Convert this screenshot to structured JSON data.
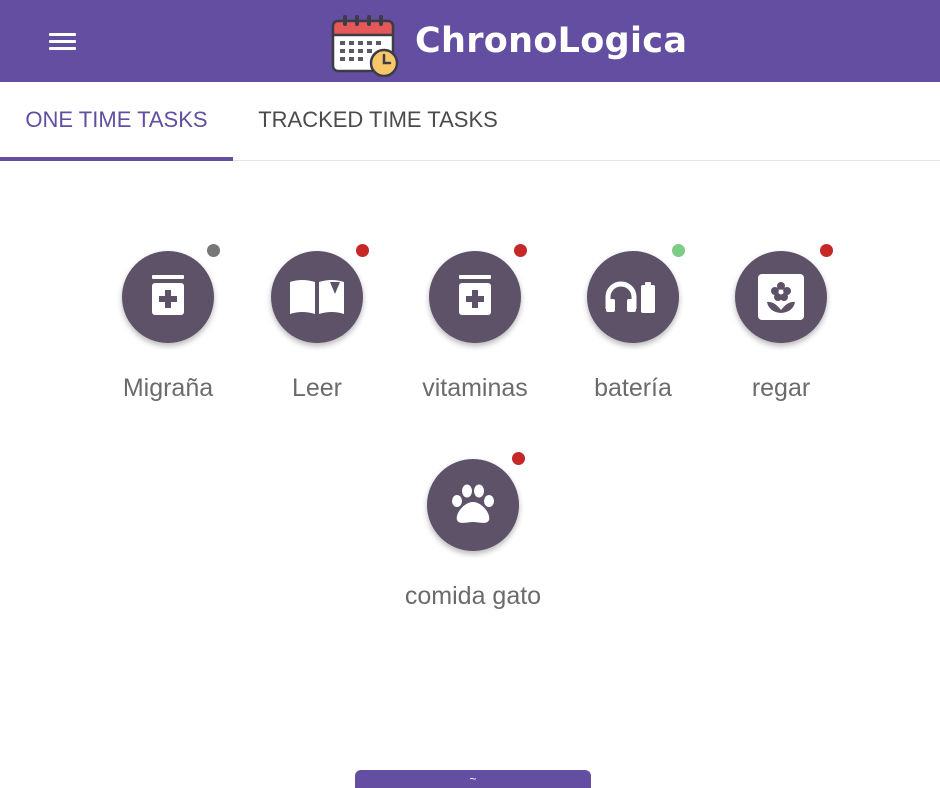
{
  "app": {
    "title": "ChronoLogica",
    "menu_icon": "menu-icon",
    "logo_icon": "calendar-clock-icon",
    "brand_color": "#634ea1"
  },
  "tabs": [
    {
      "label": "ONE TIME TASKS",
      "active": true
    },
    {
      "label": "TRACKED TIME TASKS",
      "active": false
    }
  ],
  "tasks": [
    {
      "label": "Migraña",
      "icon": "medicine-bottle-icon",
      "status_color": "#777777"
    },
    {
      "label": "Leer",
      "icon": "open-book-icon",
      "status_color": "#c62828"
    },
    {
      "label": "vitaminas",
      "icon": "medicine-bottle-icon",
      "status_color": "#c62828"
    },
    {
      "label": "batería",
      "icon": "headphones-battery-icon",
      "status_color": "#7ccb86"
    },
    {
      "label": "regar",
      "icon": "flower-icon",
      "status_color": "#c62828"
    },
    {
      "label": "comida gato",
      "icon": "paw-icon",
      "status_color": "#c62828"
    }
  ],
  "bottom_button": {
    "label": "~"
  }
}
